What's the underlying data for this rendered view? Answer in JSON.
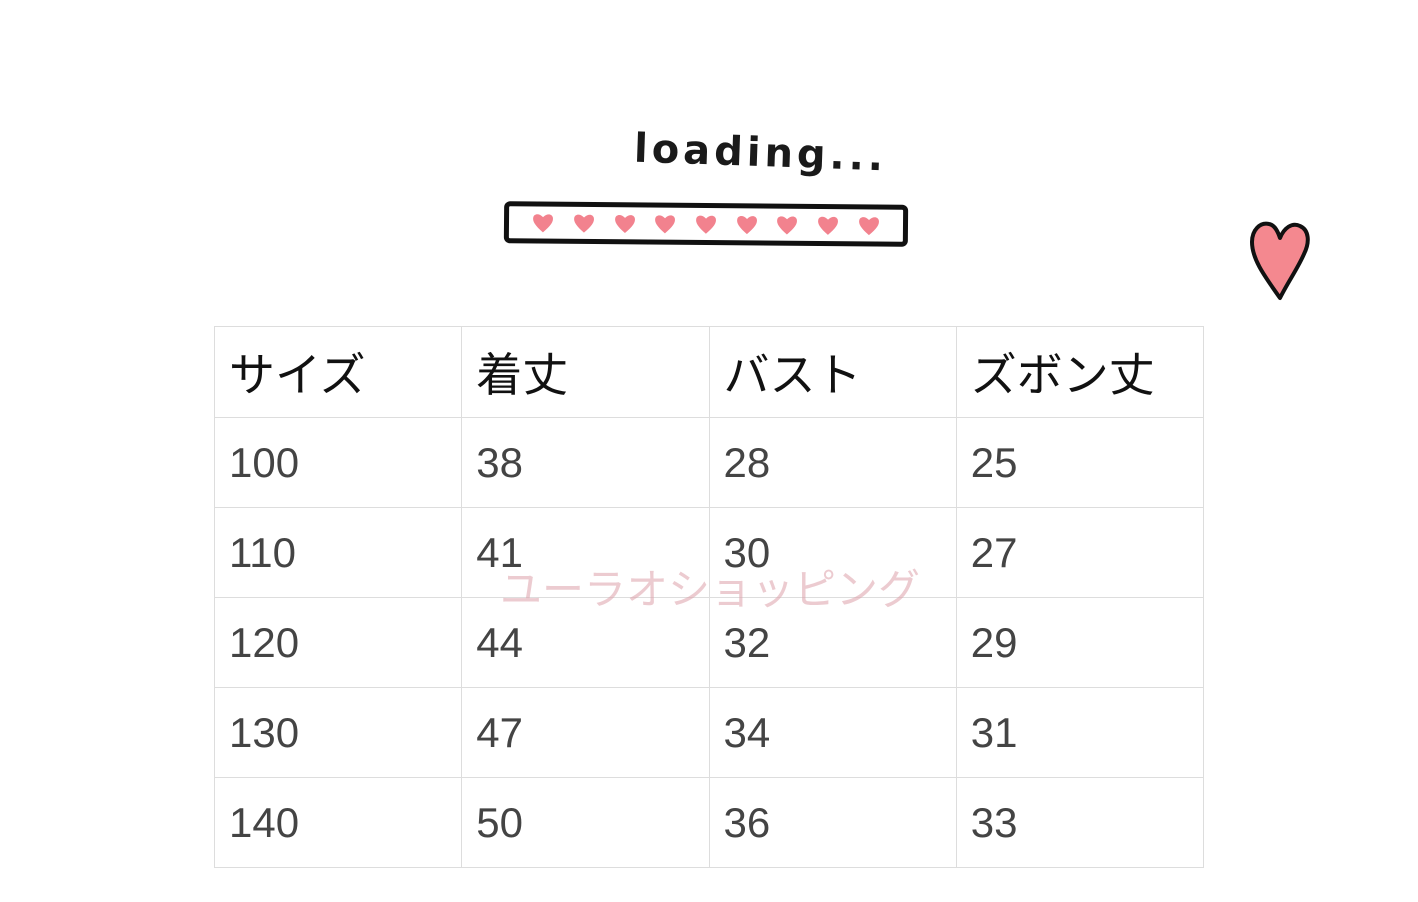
{
  "loading": {
    "label": "loading...",
    "hearts": 9
  },
  "table": {
    "headers": [
      "サイズ",
      "着丈",
      "バスト",
      "ズボン丈"
    ],
    "rows": [
      [
        "100",
        "38",
        "28",
        "25"
      ],
      [
        "110",
        "41",
        "30",
        "27"
      ],
      [
        "120",
        "44",
        "32",
        "29"
      ],
      [
        "130",
        "47",
        "34",
        "31"
      ],
      [
        "140",
        "50",
        "36",
        "33"
      ]
    ]
  },
  "watermark": "ユーラオショッピング",
  "colors": {
    "heart": "#f2828e",
    "heart_outline": "#111111",
    "grid": "#dddddd"
  }
}
